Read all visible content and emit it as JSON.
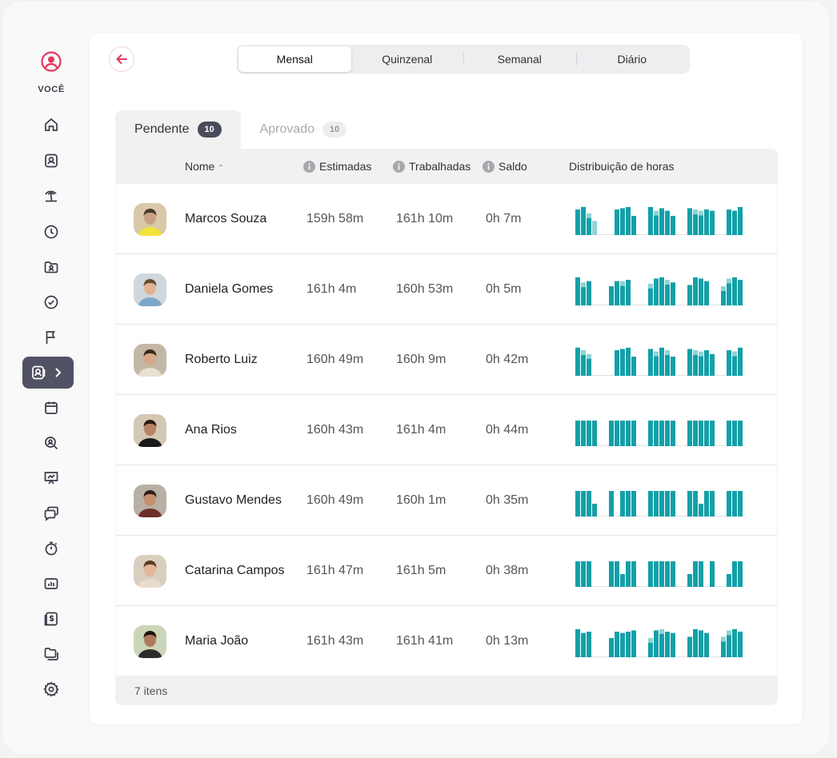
{
  "sidebar": {
    "you_label": "VOCÊ",
    "items": [
      "home-icon",
      "user-badge-icon",
      "beach-icon",
      "clock-icon",
      "folder-user-icon",
      "check-circle-icon",
      "flag-icon",
      "approval-icon",
      "calendar-icon",
      "search-user-icon",
      "presentation-icon",
      "chat-icon",
      "stopwatch-icon",
      "report-icon",
      "invoice-icon",
      "folders-icon",
      "gear-icon"
    ],
    "active_item": "approval-icon"
  },
  "periods": [
    "Mensal",
    "Quinzenal",
    "Semanal",
    "Diário"
  ],
  "active_period": "Mensal",
  "status_tabs": [
    {
      "label": "Pendente",
      "count": "10"
    },
    {
      "label": "Aprovado",
      "count": "10"
    }
  ],
  "columns": {
    "name": "Nome",
    "estimated": "Estimadas",
    "worked": "Trabalhadas",
    "balance": "Saldo",
    "distribution": "Distribuição de horas"
  },
  "rows": [
    {
      "name": "Marcos Souza",
      "estimated": "159h 58m",
      "worked": "161h 10m",
      "balance": "0h 7m",
      "bars": [
        1.0,
        1.1,
        0.85,
        0.55,
        0,
        0,
        0,
        1.0,
        1.05,
        1.1,
        0.75,
        0,
        0,
        1.1,
        0.95,
        1.05,
        0.95,
        0.75,
        0,
        0,
        1.05,
        1.0,
        0.95,
        1.0,
        0.95,
        0,
        0,
        1.0,
        0.95,
        1.1
      ],
      "light": [
        0,
        0,
        1,
        1,
        0,
        0,
        0,
        0,
        0,
        0,
        0,
        0,
        0,
        0,
        1,
        0,
        0,
        0,
        0,
        0,
        0,
        1,
        1,
        0,
        0,
        0,
        0,
        0,
        0,
        0
      ]
    },
    {
      "name": "Daniela Gomes",
      "estimated": "161h 4m",
      "worked": "160h 53m",
      "balance": "0h 5m",
      "bars": [
        1.1,
        0.9,
        0.95,
        0,
        0,
        0,
        0.75,
        0.95,
        0.95,
        1.0,
        0,
        0,
        0,
        0.85,
        1.05,
        1.1,
        1.0,
        0.9,
        0,
        0,
        0.8,
        1.1,
        1.05,
        0.95,
        0,
        0,
        0.75,
        1.05,
        1.1,
        1.0
      ],
      "light": [
        0,
        1,
        0,
        0,
        0,
        0,
        0,
        0,
        1,
        0,
        0,
        0,
        0,
        1,
        0,
        0,
        1,
        0,
        0,
        0,
        0,
        0,
        0,
        0,
        0,
        0,
        1,
        1,
        0,
        0
      ]
    },
    {
      "name": "Roberto Luiz",
      "estimated": "160h 49m",
      "worked": "160h 9m",
      "balance": "0h 42m",
      "bars": [
        1.1,
        1.0,
        0.85,
        0,
        0,
        0,
        0,
        1.0,
        1.05,
        1.1,
        0.75,
        0,
        0,
        1.05,
        0.95,
        1.1,
        1.0,
        0.75,
        0,
        0,
        1.05,
        1.0,
        0.95,
        1.0,
        0.85,
        0,
        0,
        1.0,
        0.95,
        1.1
      ],
      "light": [
        0,
        1,
        1,
        0,
        0,
        0,
        0,
        0,
        0,
        0,
        0,
        0,
        0,
        0,
        1,
        0,
        1,
        0,
        0,
        0,
        0,
        1,
        1,
        0,
        0,
        0,
        0,
        0,
        1,
        0
      ]
    },
    {
      "name": "Ana Rios",
      "estimated": "160h 43m",
      "worked": "161h 4m",
      "balance": "0h 44m",
      "bars": [
        1,
        1,
        1,
        1,
        0,
        0,
        1,
        1,
        1,
        1,
        1,
        0,
        0,
        1,
        1,
        1,
        1,
        1,
        0,
        0,
        1,
        1,
        1,
        1,
        1,
        0,
        0,
        1,
        1,
        1
      ],
      "light": [
        0,
        0,
        0,
        0,
        0,
        0,
        0,
        0,
        0,
        0,
        0,
        0,
        0,
        0,
        0,
        0,
        0,
        0,
        0,
        0,
        0,
        0,
        0,
        0,
        0,
        0,
        0,
        0,
        0,
        0
      ]
    },
    {
      "name": "Gustavo Mendes",
      "estimated": "160h 49m",
      "worked": "160h 1m",
      "balance": "0h 35m",
      "bars": [
        1,
        1,
        1,
        0.5,
        0,
        0,
        1,
        0,
        1,
        1,
        1,
        0,
        0,
        1,
        1,
        1,
        1,
        1,
        0,
        0,
        1,
        1,
        0.5,
        1,
        1,
        0,
        0,
        1,
        1,
        1
      ],
      "light": [
        0,
        0,
        0,
        0,
        0,
        0,
        0,
        0,
        0,
        0,
        0,
        0,
        0,
        0,
        0,
        0,
        0,
        0,
        0,
        0,
        0,
        0,
        0,
        0,
        0,
        0,
        0,
        0,
        0,
        0
      ]
    },
    {
      "name": "Catarina Campos",
      "estimated": "161h 47m",
      "worked": "161h 5m",
      "balance": "0h 38m",
      "bars": [
        1,
        1,
        1,
        0,
        0,
        0,
        1,
        1,
        0.5,
        1,
        1,
        0,
        0,
        1,
        1,
        1,
        1,
        1,
        0,
        0,
        0.5,
        1,
        1,
        0,
        1,
        0,
        0,
        0.5,
        1,
        1
      ],
      "light": [
        0,
        0,
        0,
        0,
        0,
        0,
        0,
        0,
        0,
        0,
        0,
        0,
        0,
        0,
        0,
        0,
        0,
        0,
        0,
        0,
        0,
        0,
        0,
        0,
        0,
        0,
        0,
        0,
        0,
        0
      ]
    },
    {
      "name": "Maria João",
      "estimated": "161h 43m",
      "worked": "161h 41m",
      "balance": "0h 13m",
      "bars": [
        1.1,
        0.95,
        1.0,
        0,
        0,
        0,
        0.75,
        1.0,
        0.95,
        1.0,
        1.05,
        0,
        0,
        0.75,
        1.05,
        1.1,
        1.0,
        0.95,
        0,
        0,
        0.8,
        1.1,
        1.05,
        0.95,
        0,
        0,
        0.8,
        1.05,
        1.1,
        1.0
      ],
      "light": [
        0,
        0,
        0,
        0,
        0,
        0,
        0,
        0,
        0,
        0,
        0,
        0,
        0,
        1,
        0,
        1,
        0,
        0,
        0,
        0,
        0,
        0,
        0,
        0,
        0,
        0,
        1,
        1,
        0,
        0
      ]
    }
  ],
  "footer": "7 itens",
  "colors": {
    "accent": "#e8365d",
    "bar": "#13a0a8",
    "bar_light": "#8fd3d3",
    "sidebar_active": "#515264"
  }
}
